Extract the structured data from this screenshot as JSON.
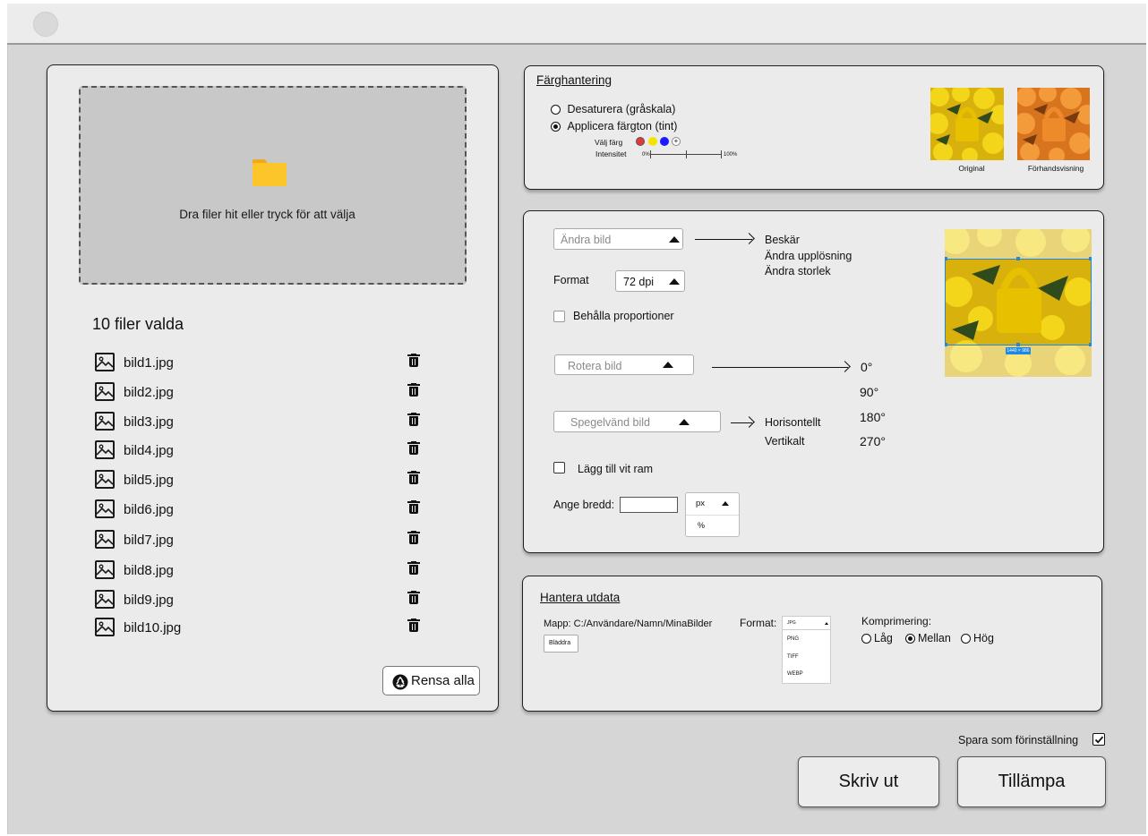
{
  "left_panel": {
    "drop_text": "Dra filer hit eller tryck för att välja",
    "files_count": "10 filer valda",
    "files": [
      {
        "name": "bild1.jpg"
      },
      {
        "name": "bild2.jpg"
      },
      {
        "name": "bild3.jpg"
      },
      {
        "name": "bild4.jpg"
      },
      {
        "name": "bild5.jpg"
      },
      {
        "name": "bild6.jpg"
      },
      {
        "name": "bild7.jpg"
      },
      {
        "name": "bild8.jpg"
      },
      {
        "name": "bild9.jpg"
      },
      {
        "name": "bild10.jpg"
      }
    ],
    "clear_all_label": "Rensa alla"
  },
  "color": {
    "title": "Färghantering",
    "option_desaturate": "Desaturera (gråskala)",
    "option_tint": "Applicera färgton (tint)",
    "selected_option": "tint",
    "choose_color_label": "Välj färg",
    "swatches": [
      "#e53935",
      "#f5e400",
      "#1a1aff"
    ],
    "intensity_label": "Intensitet",
    "intensity_min": "0%",
    "intensity_max": "100%",
    "intensity_level": 0.5,
    "original_label": "Original",
    "preview_label": "Förhandsvisning"
  },
  "edit": {
    "edit_select": "Ändra bild",
    "edit_options": [
      "Beskär",
      "Ändra upplösning",
      "Ändra storlek"
    ],
    "format_label": "Format",
    "dpi_value": "72 dpi",
    "keep_proportions": "Behålla proportioner",
    "rotate_select": "Rotera bild",
    "rotate_options": [
      "0°",
      "90°",
      "180°",
      "270°"
    ],
    "mirror_select": "Spegelvänd bild",
    "mirror_options": [
      "Horisontellt",
      "Vertikalt"
    ],
    "white_frame": "Lägg till vit ram",
    "width_label": "Ange bredd:",
    "width_value": "",
    "unit_options": [
      "px",
      "%"
    ],
    "crop_size": "1440 × 986"
  },
  "output": {
    "title": "Hantera utdata",
    "folder": "Mapp: C:/Användare/Namn/MinaBilder",
    "browse_label": "Bläddra",
    "format_label": "Format:",
    "format_selected": "JPG",
    "format_options": [
      "PNG",
      "TIFF",
      "WEBP"
    ],
    "compression_label": "Komprimering:",
    "compression_options": [
      "Låg",
      "Mellan",
      "Hög"
    ],
    "compression_selected": "Mellan"
  },
  "footer": {
    "save_preset": "Spara som förinställning",
    "save_preset_checked": true,
    "print_label": "Skriv ut",
    "apply_label": "Tillämpa"
  }
}
